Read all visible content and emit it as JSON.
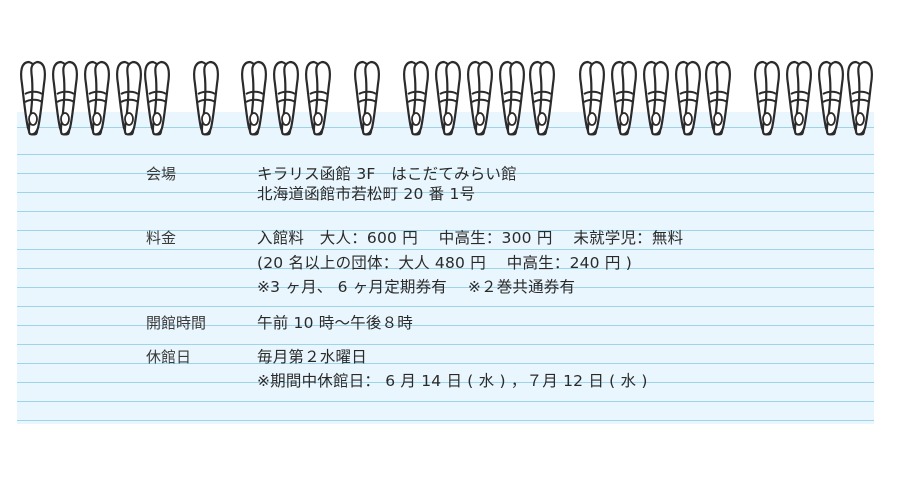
{
  "info": [
    {
      "label": "会場",
      "lines": [
        "キラリス函館 3F　はこだてみらい館",
        "北海道函館市若松町 20 番 1号"
      ]
    },
    {
      "label": "料金",
      "lines": [
        "入館料　大人：600 円　 中高生：300 円　 未就学児：無料",
        "(20 名以上の団体：大人 480 円　 中高生：240 円 )",
        "※3 ヶ月、 6 ヶ月定期券有　 ※２巻共通券有"
      ]
    },
    {
      "label": "開館時間",
      "lines": [
        "午前 10 時〜午後８時"
      ]
    },
    {
      "label": "休館日",
      "lines": [
        "毎月第２水曜日",
        "※期間中休館日： 6 月 14 日 ( 水 ) ，７月 12 日 ( 水 )"
      ]
    }
  ],
  "colors": {
    "paper": "#e9f6fd",
    "rule_line": "#9ed3e8",
    "ring": "#ffffff",
    "ring_outline": "#2b2b2b"
  }
}
